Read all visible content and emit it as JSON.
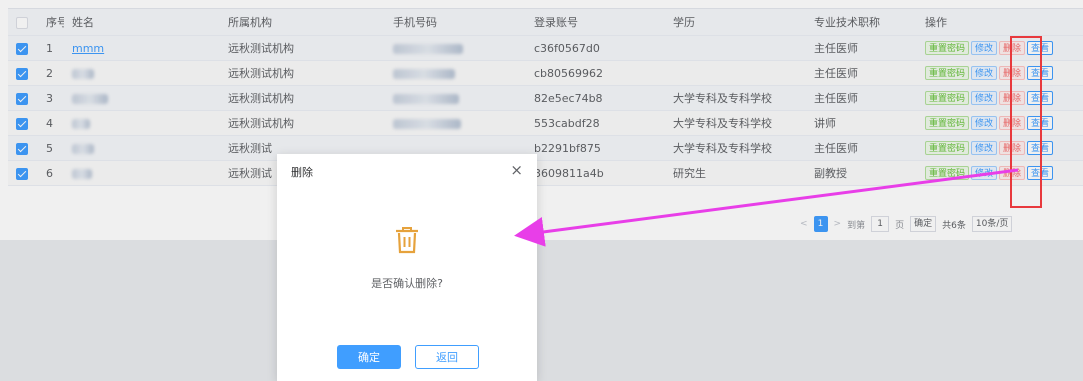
{
  "table": {
    "headers": [
      "序号",
      "姓名",
      "所属机构",
      "手机号码",
      "登录账号",
      "学历",
      "专业技术职称",
      "操作"
    ],
    "rows": [
      {
        "index": "1",
        "name": "mmm",
        "org": "远秋测试机构",
        "login": "c36f0567d0",
        "edu": "",
        "title": "主任医师",
        "checked": true
      },
      {
        "index": "2",
        "name": "",
        "org": "远秋测试机构",
        "login": "cb80569962",
        "edu": "",
        "title": "主任医师",
        "checked": true
      },
      {
        "index": "3",
        "name": "",
        "org": "远秋测试机构",
        "login": "82e5ec74b8",
        "edu": "大学专科及专科学校",
        "title": "主任医师",
        "checked": true
      },
      {
        "index": "4",
        "name": "",
        "org": "远秋测试机构",
        "login": "553cabdf28",
        "edu": "大学专科及专科学校",
        "title": "讲师",
        "checked": true
      },
      {
        "index": "5",
        "name": "",
        "org": "远秋测试",
        "login": "b2291bf875",
        "edu": "大学专科及专科学校",
        "title": "主任医师",
        "checked": true
      },
      {
        "index": "6",
        "name": "",
        "org": "远秋测试",
        "login": "3609811a4b",
        "edu": "研究生",
        "title": "副教授",
        "checked": true
      }
    ],
    "ops": {
      "reset": "重置密码",
      "edit": "修改",
      "delete": "删除",
      "view": "查看"
    }
  },
  "pagination": {
    "prev": "<",
    "page": "1",
    "next": ">",
    "goto_label": "到第",
    "goto_value": "1",
    "page_unit": "页",
    "confirm": "确定",
    "total": "共6条",
    "page_size": "10条/页"
  },
  "dialog": {
    "title": "删除",
    "close": "×",
    "message": "是否确认删除?",
    "ok": "确定",
    "back": "返回"
  },
  "colors": {
    "primary": "#409eff",
    "annotation": "#e8393d",
    "arrow": "#e83ee8",
    "warning": "#e6a23c"
  },
  "icons": {
    "trash": "trash-icon",
    "close": "close-icon",
    "checkbox": "checkbox-icon"
  }
}
